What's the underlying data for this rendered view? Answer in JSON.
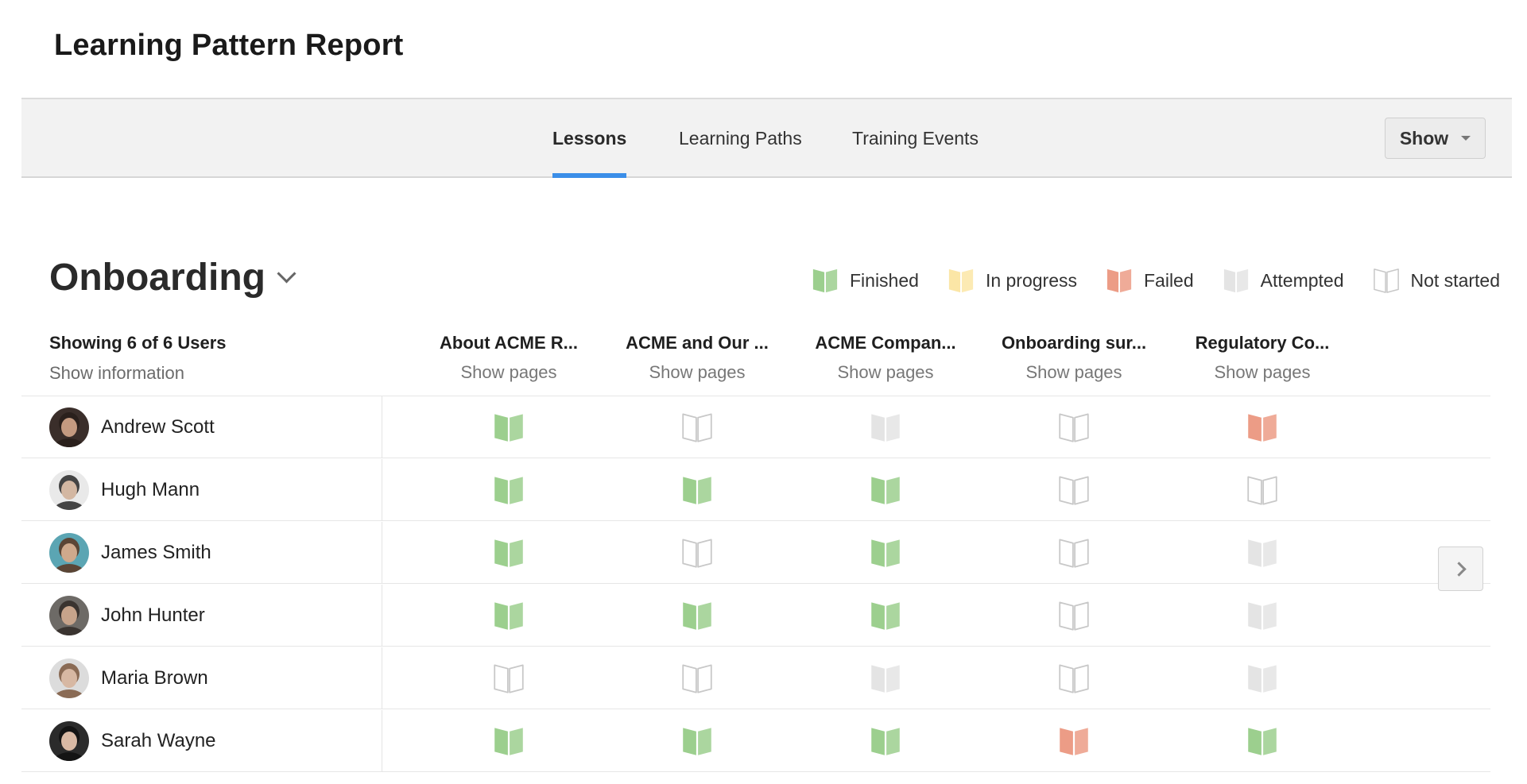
{
  "page": {
    "title": "Learning Pattern Report"
  },
  "tabs": [
    {
      "label": "Lessons",
      "active": true
    },
    {
      "label": "Learning Paths",
      "active": false
    },
    {
      "label": "Training Events",
      "active": false
    }
  ],
  "show_button": {
    "label": "Show"
  },
  "section": {
    "title": "Onboarding"
  },
  "legend": [
    {
      "label": "Finished",
      "status": "finished"
    },
    {
      "label": "In progress",
      "status": "in-progress"
    },
    {
      "label": "Failed",
      "status": "failed"
    },
    {
      "label": "Attempted",
      "status": "attempted"
    },
    {
      "label": "Not started",
      "status": "not-started"
    }
  ],
  "status_colors": {
    "finished": "#9ccf8e",
    "in-progress": "#fbe6a6",
    "failed": "#ec9c86",
    "attempted": "#e4e4e4",
    "not-started": "#ffffff"
  },
  "table": {
    "users_count": "Showing 6 of 6 Users",
    "show_information": "Show information",
    "columns": [
      {
        "title": "About ACME R...",
        "subtitle": "Show pages"
      },
      {
        "title": "ACME and Our ...",
        "subtitle": "Show pages"
      },
      {
        "title": "ACME Compan...",
        "subtitle": "Show pages"
      },
      {
        "title": "Onboarding sur...",
        "subtitle": "Show pages"
      },
      {
        "title": "Regulatory Co...",
        "subtitle": "Show pages"
      }
    ],
    "rows": [
      {
        "name": "Andrew Scott",
        "avatar": "avatar-andrew",
        "statuses": [
          "finished",
          "not-started",
          "attempted",
          "not-started",
          "failed"
        ]
      },
      {
        "name": "Hugh Mann",
        "avatar": "avatar-hugh",
        "statuses": [
          "finished",
          "finished",
          "finished",
          "not-started",
          "not-started"
        ]
      },
      {
        "name": "James Smith",
        "avatar": "avatar-james",
        "statuses": [
          "finished",
          "not-started",
          "finished",
          "not-started",
          "attempted"
        ]
      },
      {
        "name": "John Hunter",
        "avatar": "avatar-john",
        "statuses": [
          "finished",
          "finished",
          "finished",
          "not-started",
          "attempted"
        ]
      },
      {
        "name": "Maria Brown",
        "avatar": "avatar-maria",
        "statuses": [
          "not-started",
          "not-started",
          "attempted",
          "not-started",
          "attempted"
        ]
      },
      {
        "name": "Sarah Wayne",
        "avatar": "avatar-sarah",
        "statuses": [
          "finished",
          "finished",
          "finished",
          "failed",
          "finished"
        ]
      }
    ]
  },
  "icons": {
    "book": "book-icon",
    "next": "chevron-right-icon",
    "dropdown": "chevron-down-icon"
  }
}
